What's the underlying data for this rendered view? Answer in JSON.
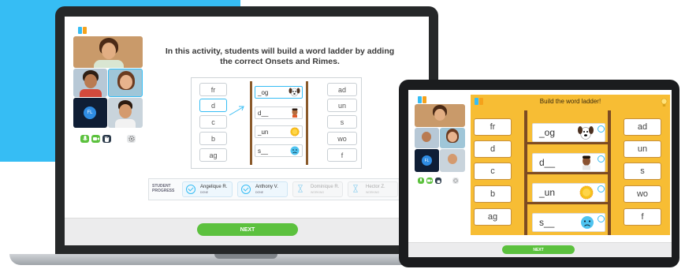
{
  "laptop": {
    "instruction": "In this activity, students will build a word ladder by adding the correct Onsets and Rimes.",
    "participants": [
      {
        "initials": ""
      },
      {
        "initials": ""
      },
      {
        "initials": ""
      },
      {
        "initials": "FL"
      },
      {
        "initials": ""
      }
    ],
    "onsets": [
      "fr",
      "d",
      "c",
      "b",
      "ag"
    ],
    "rimes": [
      "ad",
      "un",
      "s",
      "wo",
      "f"
    ],
    "ladder": [
      "_og",
      "d__",
      "_un",
      "s__"
    ],
    "student_progress": {
      "label_line1": "STUDENT",
      "label_line2": "PROGRESS",
      "students": [
        {
          "name": "Angelique R.",
          "status": "DONE",
          "state": "done"
        },
        {
          "name": "Anthony V.",
          "status": "DONE",
          "state": "done"
        },
        {
          "name": "Dominique R.",
          "status": "WORKING",
          "state": "waiting"
        },
        {
          "name": "Hector Z.",
          "status": "WORKING",
          "state": "waiting"
        }
      ]
    },
    "next_label": "NEXT"
  },
  "tablet": {
    "title": "Build the word ladder!",
    "onsets": [
      "fr",
      "d",
      "c",
      "b",
      "ag"
    ],
    "rimes": [
      "ad",
      "un",
      "s",
      "wo",
      "f"
    ],
    "ladder": [
      "_og",
      "d__",
      "_un",
      "s__"
    ],
    "next_label": "NEXT"
  },
  "colors": {
    "brand_blue": "#36bdf4",
    "accent_green": "#5cc13e",
    "board_yellow": "#f7bd34",
    "ladder_brown": "#7d4b22"
  },
  "icons": {
    "mic": "mic-icon",
    "camera": "camera-icon",
    "hand": "hand-icon",
    "settings": "gear-icon",
    "speaker": "speaker-icon",
    "hourglass": "hourglass-icon",
    "check": "check-circle-icon"
  }
}
